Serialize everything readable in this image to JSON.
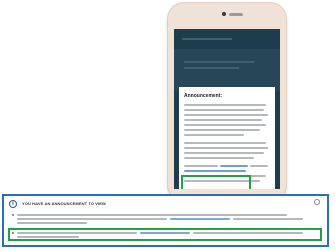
{
  "announcement_card": {
    "title": "Announcement:"
  },
  "banner": {
    "title": "YOU HAVE AN ANNOUNCEMENT TO VIEW"
  },
  "colors": {
    "phone_body": "#f1e2d8",
    "app_background": "#1d3c4c",
    "banner_border": "#2c6fb5",
    "highlight": "#22a14b",
    "link": "#6f9fd6"
  },
  "icons": {
    "banner_icon": "info-icon",
    "dismiss_icon": "close-icon"
  }
}
